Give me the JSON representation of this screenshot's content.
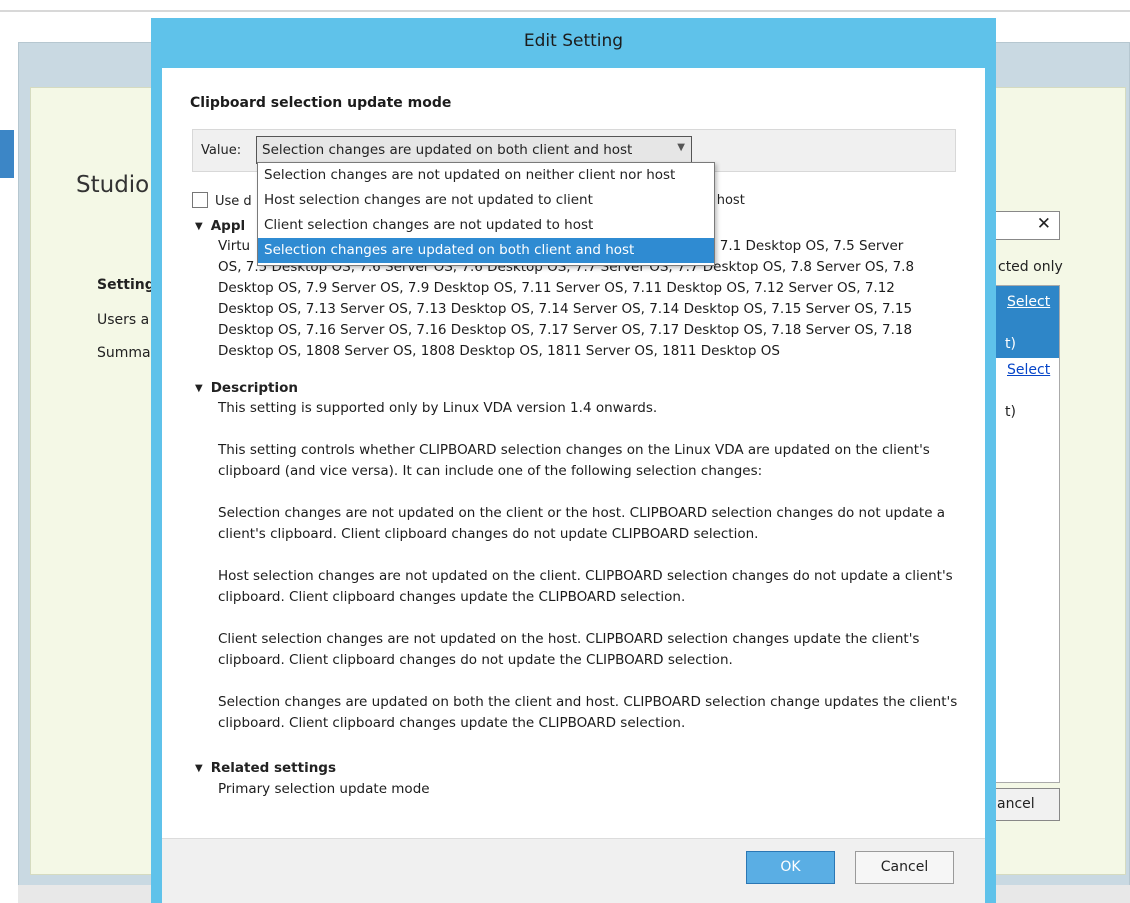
{
  "background": {
    "studio_title": "Studio",
    "nav": [
      "Setting",
      "Users a",
      "Summa"
    ],
    "search_clear_icon": "close-icon",
    "filter_text": "cted only",
    "list_items": [
      {
        "link": "Select",
        "text": "t)"
      },
      {
        "link": "Select",
        "text": "t)"
      }
    ],
    "cancel_label": "ancel"
  },
  "dialog": {
    "title": "Edit Setting",
    "setting_title": "Clipboard selection update mode",
    "value_label": "Value:",
    "selected_value": "Selection changes are updated on both client and host",
    "dropdown_options": [
      "Selection changes are not updated on neither client nor host",
      "Host selection changes are not updated to client",
      "Client selection changes are not updated to host",
      "Selection changes are updated on both client and host"
    ],
    "selected_index": 3,
    "use_default_visible": "Use d",
    "use_default_tail": "l host",
    "applies_to_heading": "Appl",
    "applies_to_visible_first_line_start": "Virtu",
    "applies_to_first_line_tail": "OS, 7.1 Desktop OS, 7.5 Server",
    "applies_to_second_line_start": "OS, 7.5 Desktop OS, 7.6 Server OS, 7.6 Desktop OS, 7.7 Server OS, 7.7 Desktop OS, 7.8 Server OS, 7.8",
    "applies_to_lines": [
      "Desktop OS, 7.9 Server OS, 7.9 Desktop OS, 7.11 Server OS, 7.11 Desktop OS, 7.12 Server OS, 7.12",
      "Desktop OS, 7.13 Server OS, 7.13 Desktop OS, 7.14 Server OS, 7.14 Desktop OS, 7.15 Server OS, 7.15",
      "Desktop OS, 7.16 Server OS, 7.16 Desktop OS, 7.17 Server OS, 7.17 Desktop OS, 7.18 Server OS, 7.18",
      "Desktop OS, 1808 Server OS, 1808 Desktop OS, 1811 Server OS, 1811 Desktop OS"
    ],
    "description_heading": "Description",
    "description_paragraphs": [
      "This setting is supported only by Linux VDA version 1.4 onwards.",
      "This setting controls whether CLIPBOARD selection changes on the Linux VDA are updated on the client's clipboard (and vice versa). It can include one of the following selection changes:",
      "Selection changes are not updated on the client or the host. CLIPBOARD selection changes do not update a client's clipboard. Client clipboard changes do not update CLIPBOARD selection.",
      "Host selection changes are not updated on the client. CLIPBOARD selection changes do not update a client's clipboard. Client clipboard changes update the CLIPBOARD selection.",
      "Client selection changes are not updated on the host. CLIPBOARD selection changes update the client's clipboard. Client clipboard changes do not update the CLIPBOARD selection.",
      "Selection changes are updated on both the client and host. CLIPBOARD selection change updates the client's clipboard. Client clipboard changes update the CLIPBOARD selection."
    ],
    "related_heading": "Related settings",
    "related_items": [
      "Primary selection update mode"
    ],
    "ok_label": "OK",
    "cancel_label": "Cancel"
  },
  "colors": {
    "dialog_frame": "#5fc2ea",
    "selected_option": "#2f8bd2",
    "ok_button": "#5aaee4"
  }
}
